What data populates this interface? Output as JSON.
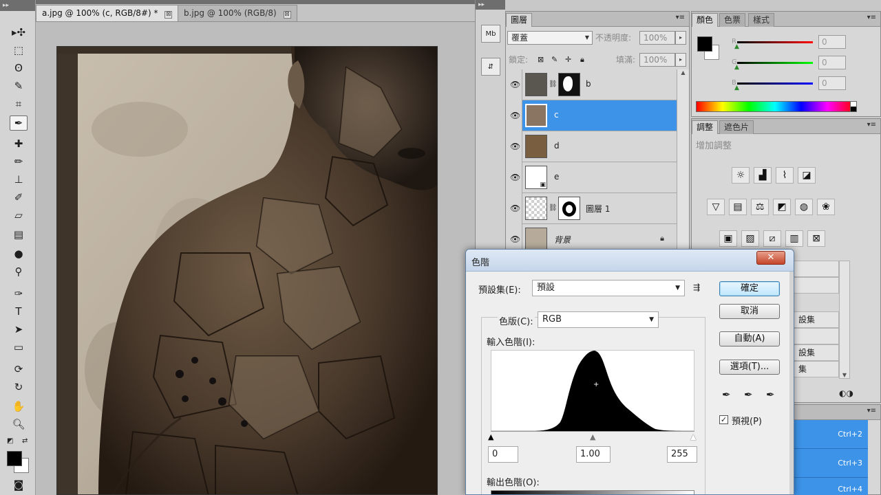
{
  "document_tabs": [
    {
      "label": "a.jpg @ 100% (c, RGB/8#) *",
      "active": true
    },
    {
      "label": "b.jpg @ 100% (RGB/8)",
      "active": false
    }
  ],
  "tab_close_glyph": "⊠",
  "layers_panel": {
    "tab": "圖層",
    "blend_mode": "覆蓋",
    "opacity_label": "不透明度:",
    "opacity_value": "100%",
    "lock_label": "鎖定:",
    "fill_label": "填滿:",
    "fill_value": "100%",
    "layers": [
      {
        "name": "b",
        "visible": true,
        "selected": false
      },
      {
        "name": "c",
        "visible": true,
        "selected": true
      },
      {
        "name": "d",
        "visible": true,
        "selected": false
      },
      {
        "name": "e",
        "visible": true,
        "selected": false
      },
      {
        "name": "圖層 1",
        "visible": true,
        "selected": false
      },
      {
        "name": "背景",
        "visible": true,
        "selected": false,
        "locked": true
      }
    ]
  },
  "color_panel": {
    "tabs": [
      "顏色",
      "色票",
      "樣式"
    ],
    "channels": [
      {
        "label": "R",
        "value": "0",
        "color": "#ff0000"
      },
      {
        "label": "G",
        "value": "0",
        "color": "#00cc00"
      },
      {
        "label": "B",
        "value": "0",
        "color": "#0000ff"
      }
    ]
  },
  "adjust_panel": {
    "tabs": [
      "調整",
      "遮色片"
    ],
    "title": "增加調整",
    "preset_rows": [
      "設集",
      "設集",
      "集"
    ]
  },
  "history_panel": {
    "shortcuts": [
      "Ctrl+2",
      "Ctrl+3",
      "Ctrl+4"
    ]
  },
  "levels_dialog": {
    "title": "色階",
    "close_glyph": "✕",
    "preset_label": "預設集(E):",
    "preset_value": "預設",
    "channel_label": "色版(C):",
    "channel_value": "RGB",
    "input_label": "輸入色階(I):",
    "input_values": [
      "0",
      "1.00",
      "255"
    ],
    "output_label": "輸出色階(O):",
    "buttons": {
      "ok": "確定",
      "cancel": "取消",
      "auto": "自動(A)",
      "options": "選項(T)..."
    },
    "preview_label": "預視(P)",
    "preview_checked": true
  },
  "foreground_color": "#000000",
  "background_color": "#ffffff",
  "selection_color": "#3d93e8"
}
